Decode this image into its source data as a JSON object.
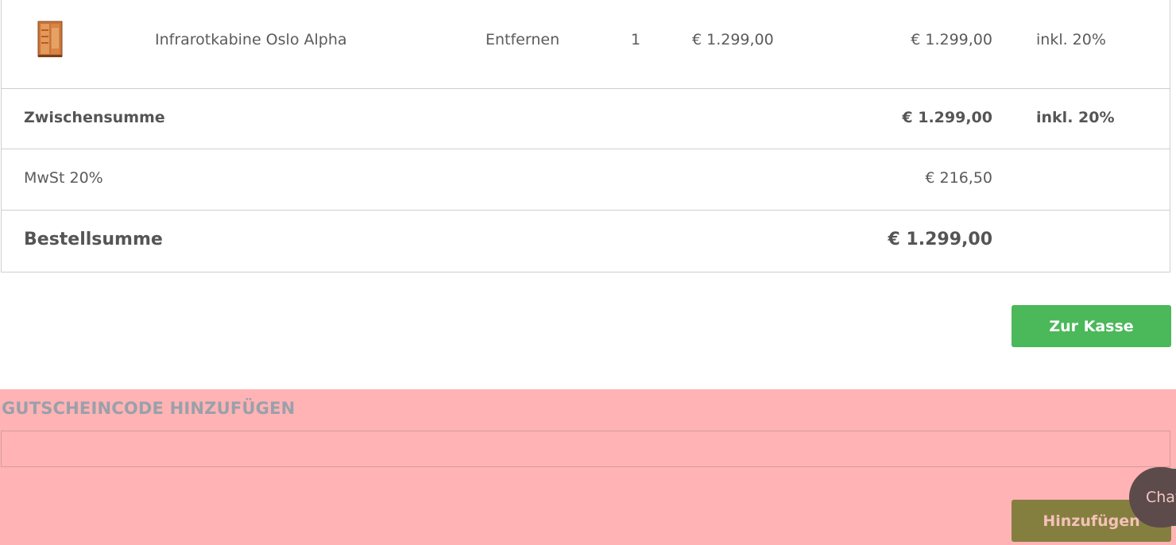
{
  "cart": {
    "item": {
      "name": "Infrarotkabine Oslo Alpha",
      "remove_label": "Entfernen",
      "quantity": "1",
      "unit_price": "€ 1.299,00",
      "total": "€ 1.299,00",
      "tax": "inkl. 20%"
    },
    "subtotal": {
      "label": "Zwischensumme",
      "value": "€ 1.299,00",
      "tax": "inkl. 20%"
    },
    "vat": {
      "label": "MwSt 20%",
      "value": "€ 216,50"
    },
    "order_total": {
      "label": "Bestellsumme",
      "value": "€ 1.299,00"
    }
  },
  "checkout_button": "Zur Kasse",
  "coupon": {
    "title": "GUTSCHEINCODE HINZUFÜGEN",
    "input_value": "",
    "add_button": "Hinzufügen"
  },
  "chat": {
    "label": "Chat"
  },
  "colors": {
    "checkout": "#4bb85a",
    "add_button": "#857f3f",
    "coupon_bg": "#ffb3b5"
  }
}
